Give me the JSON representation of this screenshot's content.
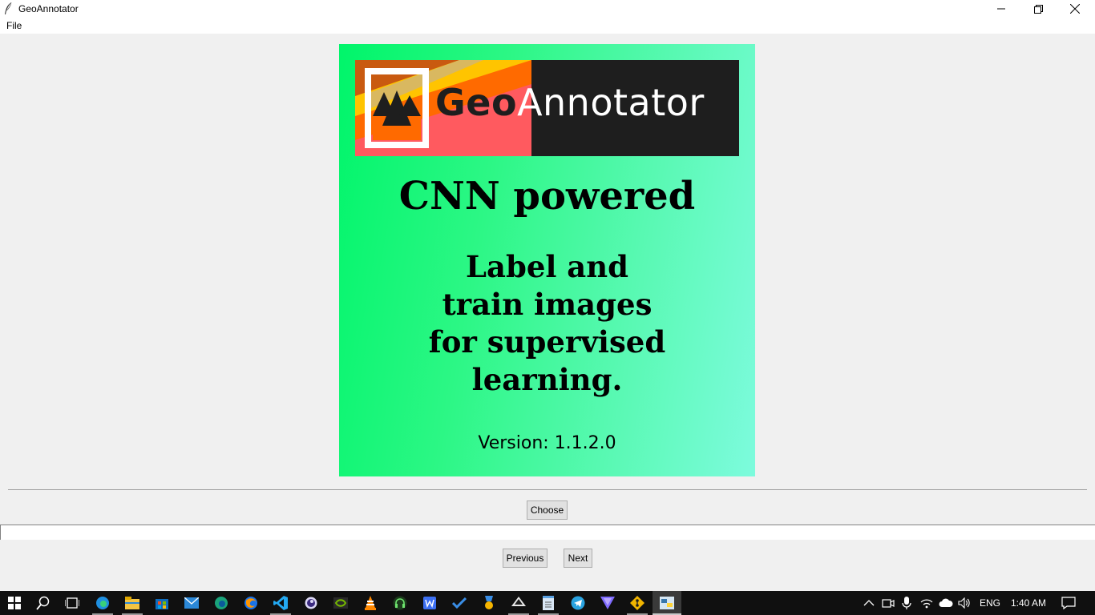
{
  "window": {
    "title": "GeoAnnotator",
    "icon": "feather-icon",
    "controls": [
      "minimize-icon",
      "restore-icon",
      "close-icon"
    ]
  },
  "menu": {
    "file_label": "File"
  },
  "splash": {
    "logo_geo": "Geo",
    "logo_annotator": "Annotator",
    "headline": "CNN powered",
    "tagline_lines": [
      "Label and",
      "train images",
      "for supervised",
      "learning."
    ],
    "version": "Version: 1.1.2.0",
    "colors": {
      "gradient_start": "#00f56a",
      "gradient_end": "#7dfbdd",
      "logo_dark": "#1e1e1e"
    }
  },
  "controls": {
    "choose_label": "Choose",
    "path_value": "",
    "previous_label": "Previous",
    "next_label": "Next"
  },
  "taskbar": {
    "apps": [
      "edge-icon",
      "file-explorer-icon",
      "store-icon",
      "mail-icon",
      "edge-dev-icon",
      "firefox-icon",
      "vscode-icon",
      "obs-icon",
      "nvidia-icon",
      "vlc-icon",
      "headset-app-icon",
      "wps-icon",
      "todo-icon",
      "badge-app-icon",
      "inkscape-icon",
      "notepad-icon",
      "telegram-icon",
      "proton-vpn-icon",
      "git-icon",
      "python-icon"
    ],
    "language": "ENG",
    "time": "1:40 AM"
  }
}
